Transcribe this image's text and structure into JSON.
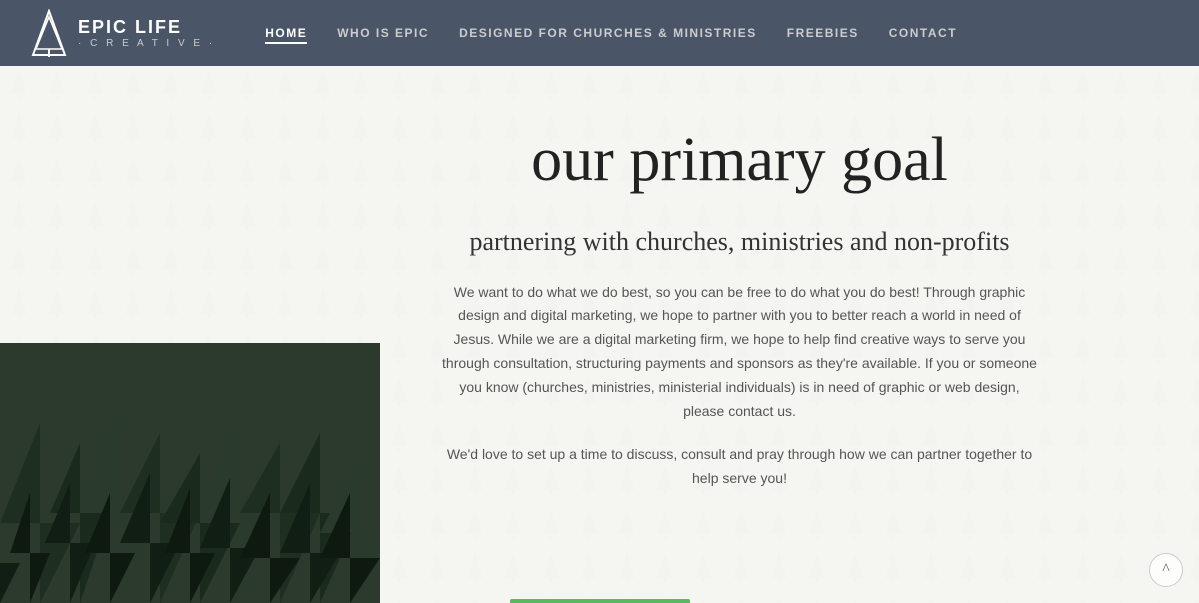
{
  "nav": {
    "logo": {
      "title": "EPIC LIFE",
      "subtitle": "· C R E A T I V E ·"
    },
    "links": [
      {
        "label": "HOME",
        "active": true
      },
      {
        "label": "WHO IS EPIC",
        "active": false
      },
      {
        "label": "DESIGNED FOR CHURCHES & MINISTRIES",
        "active": false
      },
      {
        "label": "FREEBIES",
        "active": false
      },
      {
        "label": "CONTACT",
        "active": false
      }
    ]
  },
  "main": {
    "primary_goal": "our primary goal",
    "subtitle": "partnering with churches, ministries and non-profits",
    "body_text": "We want to do what we do best, so you can be free to do what you do best! Through graphic design and digital marketing, we hope to partner with you to better reach a world in need of Jesus. While we are a digital marketing firm, we hope to help find creative ways to serve you through consultation, structuring payments and sponsors as they're available. If you or someone you know (churches, ministries, ministerial individuals) is in need of graphic or web design, please contact us.",
    "body_text_2": "We'd love to set up a time to discuss, consult and pray through how we can partner together to help serve you!"
  },
  "scroll_top_label": "^"
}
